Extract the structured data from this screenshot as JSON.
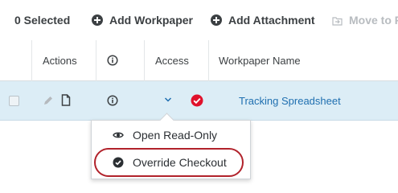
{
  "toolbar": {
    "selected_count": "0 Selected",
    "add_workpaper": "Add Workpaper",
    "add_attachment": "Add Attachment",
    "move_to": "Move to F"
  },
  "table": {
    "headers": {
      "actions": "Actions",
      "access": "Access",
      "workpaper_name": "Workpaper Name"
    },
    "row": {
      "name": "Tracking Spreadsheet"
    }
  },
  "menu": {
    "items": [
      {
        "label": "Open Read-Only",
        "icon": "eye-icon"
      },
      {
        "label": "Override Checkout",
        "icon": "check-circle-icon"
      }
    ]
  },
  "colors": {
    "selected_row": "#dcedf6",
    "link": "#1f6fb0",
    "checkout_badge": "#e0112b",
    "highlight_ring": "#b1222b"
  }
}
